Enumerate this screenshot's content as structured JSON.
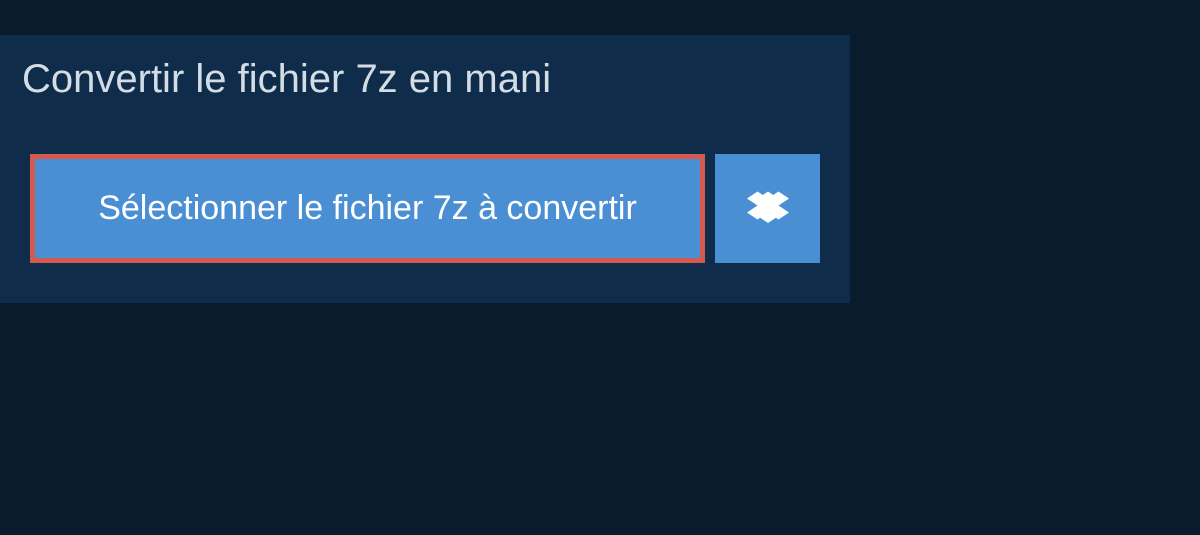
{
  "title": "Convertir le fichier 7z en mani",
  "actions": {
    "select_file_label": "Sélectionner le fichier 7z à convertir"
  },
  "colors": {
    "page_bg": "#0a1b2e",
    "panel_bg": "#0f2d4a",
    "button_bg": "#4a8fd4",
    "highlight_border": "#d45a4f"
  }
}
